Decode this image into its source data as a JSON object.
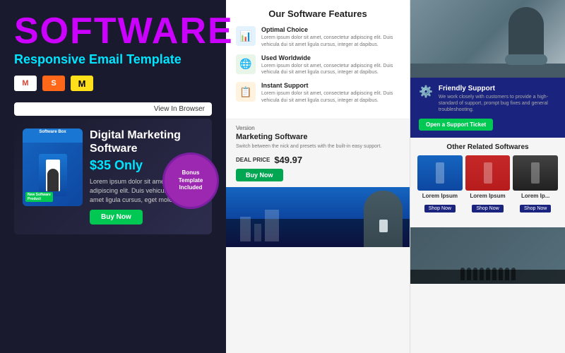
{
  "left": {
    "title": "SOFTWARE",
    "subtitle": "Responsive Email Template",
    "email_clients": [
      {
        "name": "Gmail",
        "symbol": "M",
        "bg": "gmail"
      },
      {
        "name": "Substack",
        "symbol": "S",
        "bg": "substack"
      },
      {
        "name": "Mailchimp",
        "symbol": "M",
        "bg": "mailchimp"
      }
    ],
    "view_in_browser": "View In Browser",
    "product": {
      "name": "Digital Marketing Software",
      "price": "$35 Only",
      "description": "Lorem ipsum dolor sit amet, consectetur adipiscing elit. Duis vehicula dui sit amet ligula cursus, eget molestie diam.",
      "buy_button": "Buy Now",
      "tag": "New Software Product"
    },
    "bonus": {
      "line1": "Bonus",
      "line2": "Template",
      "line3": "Included"
    }
  },
  "middle": {
    "features_title": "Our Software Features",
    "features": [
      {
        "title": "Optimal Choice",
        "icon": "📊",
        "description": "Lorem ipsum dolor sit amet, consectetur adipiscing elit. Duis vehicula dui sit amet ligula cursus, integer at dapibus."
      },
      {
        "title": "Used Worldwide",
        "icon": "🌐",
        "description": "Lorem ipsum dolor sit amet, consectetur adipiscing elit. Duis vehicula dui sit amet ligula cursus, integer at dapibus."
      },
      {
        "title": "Instant Support",
        "icon": "📋",
        "description": "Lorem ipsum dolor sit amet, consectetur adipiscing elit. Duis vehicula dui sit amet ligula cursus, integer at dapibus."
      }
    ],
    "deal": {
      "version_label": "Version",
      "title": "Marketing Software",
      "description": "Switch between the nick and presets with the built-in easy support.",
      "price_label": "DEAL PRICE",
      "price": "$49.97",
      "buy_button": "Buy Now"
    }
  },
  "right": {
    "support": {
      "title": "Friendly Support",
      "description": "We work closely with customers to provide a high-standard of support, prompt bug fixes and general troubleshooting.",
      "button": "Open a Support Ticket"
    },
    "related": {
      "title": "Other Related Softwares",
      "products": [
        {
          "label": "Lorem Ipsum",
          "shop": "Shop Now"
        },
        {
          "label": "Lorem Ipsum",
          "shop": "Shop Now"
        },
        {
          "label": "Lorem Ip...",
          "shop": "Shop Now"
        }
      ]
    }
  }
}
